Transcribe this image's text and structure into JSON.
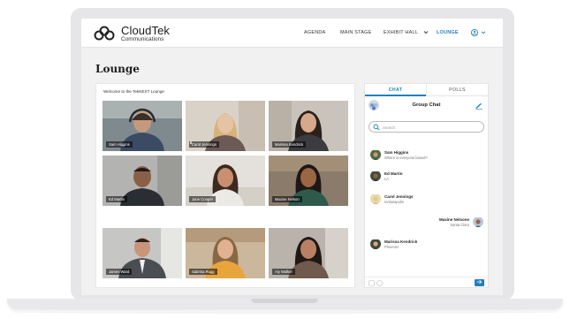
{
  "brand": {
    "name": "CloudTek",
    "subtitle": "Communications"
  },
  "nav": {
    "items": [
      "AGENDA",
      "MAIN STAGE",
      "EXHIBIT HALL",
      "LOUNGE"
    ],
    "active": "LOUNGE",
    "accent_color": "#1f7fc0"
  },
  "page": {
    "title": "Lounge"
  },
  "video": {
    "welcome": "Welcome to the TekNEXT Lounge",
    "participants": [
      {
        "name": "Sam Higgins"
      },
      {
        "name": "Carol Jennings"
      },
      {
        "name": "Marissa Kendrick"
      },
      {
        "name": "Ed Martin"
      },
      {
        "name": "Jane Cooper"
      },
      {
        "name": "Maxine Nelson"
      },
      {
        "name": "James Ward"
      },
      {
        "name": "Sabrina Rugg"
      },
      {
        "name": "Aly Walker"
      }
    ]
  },
  "chat": {
    "tabs": {
      "chat": "CHAT",
      "polls": "POLLS"
    },
    "group_title": "Group Chat",
    "search_placeholder": "Search",
    "messages": [
      {
        "name": "Sam Higgins",
        "text": "Where is everyone based?"
      },
      {
        "name": "Ed Martin",
        "text": "LA"
      },
      {
        "name": "Carol Jennings",
        "text": "Indianapolis"
      },
      {
        "name": "Maxine Nelsone",
        "text": "Santa Clara"
      },
      {
        "name": "Marissa Kendrick",
        "text": "Phoenix!"
      }
    ],
    "send_icon": "arrow-right-icon"
  }
}
